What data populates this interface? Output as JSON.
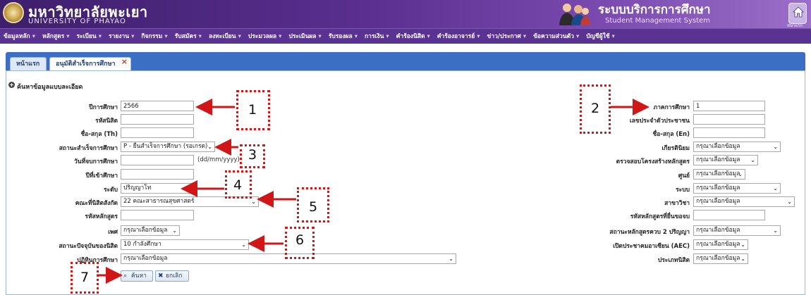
{
  "header": {
    "university_th": "มหาวิทยาลัยพะเยา",
    "university_en": "UNIVERSITY OF PHAYAO",
    "system_th": "ระบบบริการการศึกษา",
    "system_en": "Student Management System",
    "home_caption": "หน้าแรก"
  },
  "menu": [
    "ข้อมูลหลัก",
    "หลักสูตร",
    "ระเบียน",
    "รายงาน",
    "กิจกรรม",
    "รับสมัคร",
    "ลงทะเบียน",
    "ประมวลผล",
    "ประเมินผล",
    "รับรองผล",
    "การเงิน",
    "คำร้องนิสิต",
    "คำร้องอาจารย์",
    "ข่าว/ประกาศ",
    "ข้อความส่วนตัว",
    "บัญชีผู้ใช้"
  ],
  "tabs": {
    "home": "หน้าแรก",
    "active": "อนุมัติสำเร็จการศึกษา",
    "close": "×"
  },
  "section_title": "ค้นหาข้อมูลแบบละเอียด",
  "left_fields": {
    "year": {
      "label": "ปีการศึกษา",
      "value": "2566"
    },
    "student_id": {
      "label": "รหัสนิสิต",
      "value": ""
    },
    "name_th": {
      "label": "ชื่อ-สกุล (Th)",
      "value": ""
    },
    "grad_status": {
      "label": "สถานะสำเร็จการศึกษา",
      "value": "P - ยื่นสำเร็จการศึกษา (รอเกรด)"
    },
    "grad_date": {
      "label": "วันที่จบการศึกษา",
      "value": "",
      "hint": "(dd/mm/yyyy)"
    },
    "entry_year": {
      "label": "ปีที่เข้าศึกษา",
      "value": ""
    },
    "level": {
      "label": "ระดับ",
      "value": "ปริญญาโท"
    },
    "faculty": {
      "label": "คณะที่นิสิตสังกัด",
      "value": "22 คณะสาธารณสุขศาสตร์"
    },
    "curriculum_code": {
      "label": "รหัสหลักสูตร",
      "value": ""
    },
    "gender": {
      "label": "เพศ",
      "value": "กรุณาเลือกข้อมูล"
    },
    "current_status": {
      "label": "สถานะปัจจุบันของนิสิต",
      "value": "10 กำลังศึกษา"
    },
    "calendar": {
      "label": "ปฏิทินการศึกษา",
      "value": "กรุณาเลือกข้อมูล"
    }
  },
  "right_fields": {
    "semester": {
      "label": "ภาคการศึกษา",
      "value": "1"
    },
    "citizen_id": {
      "label": "เลขประจำตัวประชาชน",
      "value": ""
    },
    "name_en": {
      "label": "ชื่อ-สกุล (En)",
      "value": ""
    },
    "honors": {
      "label": "เกียรตินิยม",
      "value": "กรุณาเลือกข้อมูล"
    },
    "curriculum_check": {
      "label": "ตรวจสอบโครงสร้างหลักสูตร",
      "value": "กรุณาเลือกข้อมูล"
    },
    "center": {
      "label": "ศูนย์",
      "value": "กรุณาเลือกข้อมูล"
    },
    "system": {
      "label": "ระบบ",
      "value": "กรุณาเลือกข้อมูล"
    },
    "major": {
      "label": "สาขาวิชา",
      "value": "กรุณาเลือกข้อมูล"
    },
    "graduated_curriculum": {
      "label": "รหัสหลักสูตรที่ยื่นขอจบ",
      "value": ""
    },
    "dual_degree": {
      "label": "สถานะหลักสูตรควบ 2 ปริญญา",
      "value": "กรุณาเลือกข้อมูล"
    },
    "aec": {
      "label": "เปิดประชาคมอาเซียน (AEC)",
      "value": "กรุณาเลือกข้อมูล"
    },
    "student_type": {
      "label": "ประเภทนิสิต",
      "value": "กรุณาเลือกข้อมูล"
    }
  },
  "buttons": {
    "search": "ค้นหา",
    "cancel": "ยกเลิก"
  },
  "annotations": [
    "1",
    "2",
    "3",
    "4",
    "5",
    "6",
    "7"
  ],
  "colors": {
    "annotation": "#d01616",
    "menu_bg": "#5a3291",
    "tab_strip": "#3a6fc4"
  }
}
